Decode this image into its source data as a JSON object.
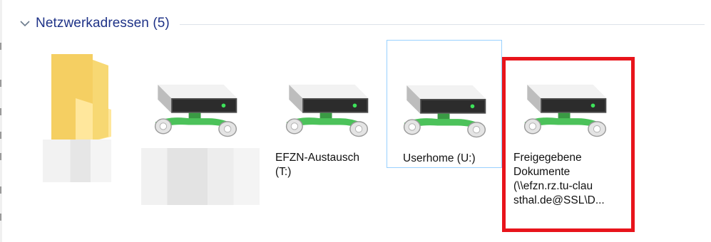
{
  "group": {
    "title": "Netzwerkadressen (5)",
    "icon": "chevron-down-icon"
  },
  "items": [
    {
      "label": "",
      "icon": "folder-icon",
      "label_obscured": true
    },
    {
      "label": "",
      "icon": "network-drive-icon",
      "label_obscured": true
    },
    {
      "label": "EFZN-Austausch\n(T:)",
      "icon": "network-drive-icon"
    },
    {
      "label": "Userhome (U:)",
      "icon": "network-drive-icon",
      "selected": true
    },
    {
      "label": "Freigegebene\nDokumente\n(\\\\efzn.rz.tu-clau\nsthal.de@SSL\\D...",
      "icon": "network-drive-icon",
      "highlighted": true
    }
  ],
  "colors": {
    "group_title": "#1e3287",
    "highlight_border": "#e8141b",
    "selection_border": "#99d1ff"
  }
}
